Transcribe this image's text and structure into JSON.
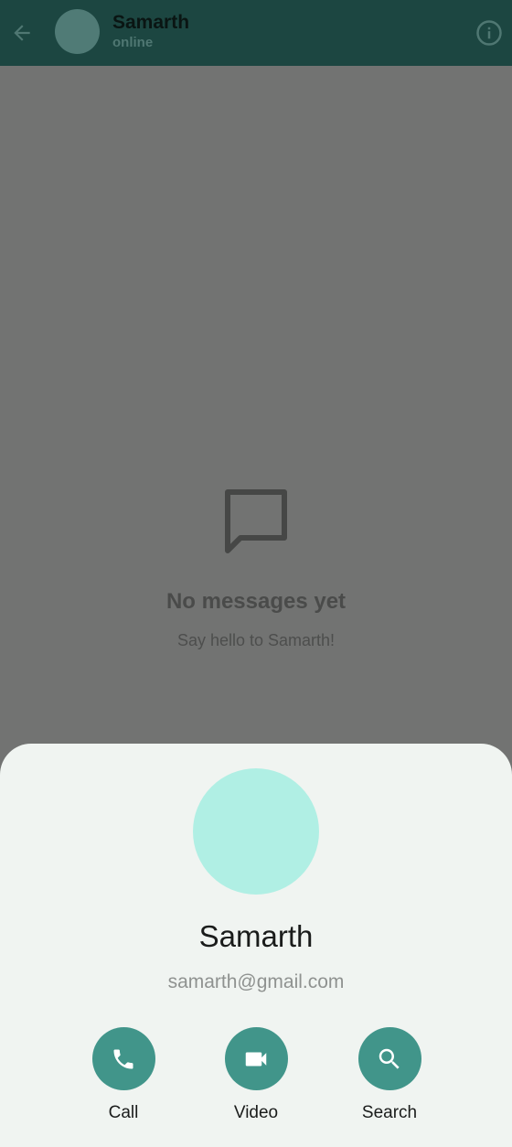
{
  "header": {
    "contact_name": "Samarth",
    "status": "online"
  },
  "empty_state": {
    "title": "No messages yet",
    "subtitle": "Say hello to Samarth!"
  },
  "profile_sheet": {
    "name": "Samarth",
    "email": "samarth@gmail.com",
    "actions": [
      {
        "label": "Call",
        "icon": "phone-icon"
      },
      {
        "label": "Video",
        "icon": "videocam-icon"
      },
      {
        "label": "Search",
        "icon": "search-icon"
      }
    ]
  },
  "colors": {
    "app_bar": "#1c4641",
    "scrim_background": "#727372",
    "sheet_background": "#f0f4f1",
    "sheet_avatar": "#b0efe4",
    "action_button": "#41958a"
  }
}
